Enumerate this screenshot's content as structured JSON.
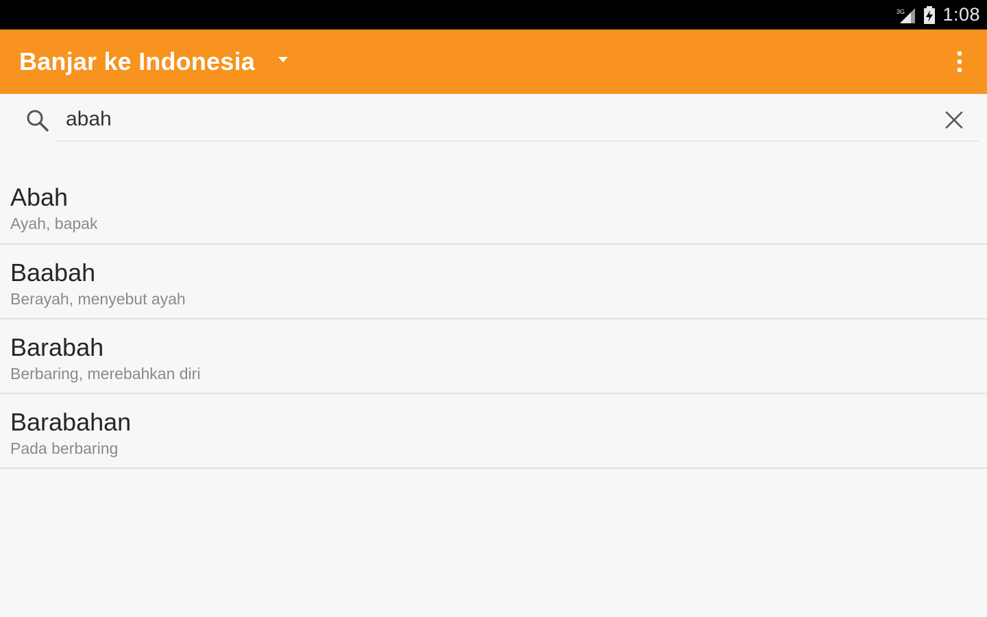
{
  "status_bar": {
    "time": "1:08",
    "signal_label": "3G",
    "icons": [
      "signal-3g-icon",
      "battery-charging-icon"
    ]
  },
  "app_bar": {
    "title": "Banjar ke Indonesia",
    "background_color": "#f7931e",
    "icons": [
      "dropdown-arrow-icon",
      "overflow-menu-icon"
    ]
  },
  "search": {
    "value": "abah",
    "icons": [
      "search-icon",
      "close-icon"
    ]
  },
  "results": [
    {
      "word": "Abah",
      "meaning": "Ayah, bapak"
    },
    {
      "word": "Baabah",
      "meaning": "Berayah, menyebut ayah"
    },
    {
      "word": "Barabah",
      "meaning": "Berbaring, merebahkan diri"
    },
    {
      "word": "Barabahan",
      "meaning": "Pada berbaring"
    }
  ]
}
